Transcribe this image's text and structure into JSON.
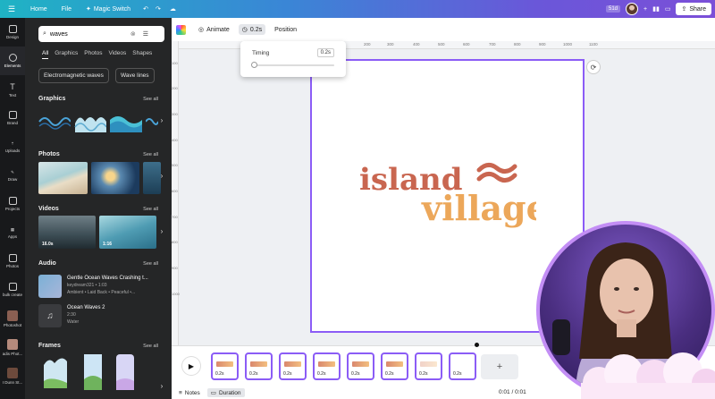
{
  "topbar": {
    "home": "Home",
    "file": "File",
    "magic_switch": "Magic Switch",
    "badge": "51d",
    "share": "Share"
  },
  "rail": [
    {
      "label": "Design"
    },
    {
      "label": "Elements"
    },
    {
      "label": "Text"
    },
    {
      "label": "Brand"
    },
    {
      "label": "Uploads"
    },
    {
      "label": "Draw"
    },
    {
      "label": "Projects"
    },
    {
      "label": "Apps"
    },
    {
      "label": "Photos"
    },
    {
      "label": "bulk create"
    },
    {
      "label": "Photoshot"
    },
    {
      "label": "adis Phot..."
    },
    {
      "label": "I Dunn St..."
    }
  ],
  "panel": {
    "search_value": "waves",
    "tabs": [
      "All",
      "Graphics",
      "Photos",
      "Videos",
      "Shapes"
    ],
    "chips": [
      "Electromagnetic waves",
      "Wave lines"
    ],
    "sections": {
      "graphics": "Graphics",
      "photos": "Photos",
      "videos": "Videos",
      "audio": "Audio",
      "frames": "Frames",
      "see_all": "See all"
    },
    "video_durations": [
      "16.0s",
      "1:16"
    ],
    "audio": [
      {
        "title": "Gentle Ocean Waves Crashing t...",
        "meta1": "keydream321 • 1:03",
        "meta2": "Ambient • Laid Back • Peaceful •..."
      },
      {
        "title": "Ocean Waves 2",
        "meta1": "2:30",
        "meta2": "Water"
      }
    ]
  },
  "toolbar": {
    "animate": "Animate",
    "duration": "0.2s",
    "position": "Position"
  },
  "ruler": {
    "h": [
      "200",
      "300",
      "400",
      "500",
      "600",
      "700",
      "800",
      "900",
      "1000",
      "1100"
    ],
    "v": [
      "100",
      "200",
      "300",
      "400",
      "500",
      "600",
      "700",
      "800",
      "900",
      "1000"
    ]
  },
  "timing": {
    "label": "Timing",
    "value": "0.2s",
    "fraction": 0.0
  },
  "logo": {
    "line1": "island",
    "line2": "village",
    "color1": "#c96650",
    "color2": "#eca75a"
  },
  "timeline": {
    "pages": [
      "0.2s",
      "0.2s",
      "0.2s",
      "0.2s",
      "0.2s",
      "0.2s",
      "0.2s",
      "0.2s"
    ],
    "add": "+"
  },
  "footer": {
    "notes": "Notes",
    "duration": "Duration",
    "time": "0:01 / 0:01"
  }
}
